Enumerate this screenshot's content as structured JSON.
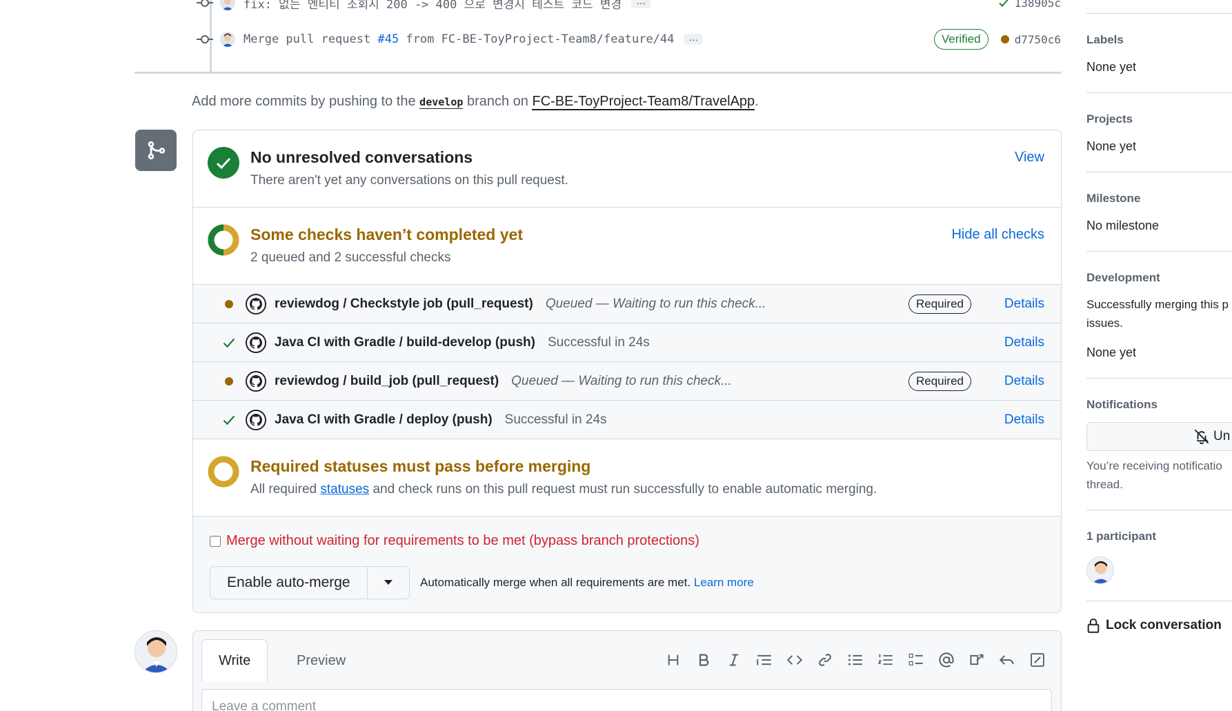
{
  "commits": [
    {
      "message_prefix": "fix: 없는 엔티티 조회시 200 -> 400 으로 변경시 테스트 코드 변경",
      "pr": "",
      "suffix": "",
      "sha": "138905c",
      "status": "success"
    },
    {
      "message_prefix": "Merge pull request",
      "pr": "#45",
      "suffix": "from FC-BE-ToyProject-Team8/feature/44",
      "sha": "d7750c6",
      "status": "pending",
      "badge": "Verified"
    }
  ],
  "add_more": {
    "pre": "Add more commits by pushing to the",
    "branch": "develop",
    "mid": "branch on",
    "repo": "FC-BE-ToyProject-Team8/TravelApp",
    "post": "."
  },
  "conversations": {
    "title": "No unresolved conversations",
    "subtitle": "There aren't yet any conversations on this pull request.",
    "action": "View"
  },
  "checks_summary": {
    "title": "Some checks haven’t completed yet",
    "subtitle": "2 queued and 2 successful checks",
    "action": "Hide all checks"
  },
  "checks": [
    {
      "status": "queued",
      "name": "reviewdog / Checkstyle job (pull_request)",
      "desc": "Queued — Waiting to run this check...",
      "required": "Required",
      "details": "Details"
    },
    {
      "status": "success",
      "name": "Java CI with Gradle / build-develop (push)",
      "desc": "Successful in 24s",
      "required": "",
      "details": "Details"
    },
    {
      "status": "queued",
      "name": "reviewdog / build_job (pull_request)",
      "desc": "Queued — Waiting to run this check...",
      "required": "Required",
      "details": "Details"
    },
    {
      "status": "success",
      "name": "Java CI with Gradle / deploy (push)",
      "desc": "Successful in 24s",
      "required": "",
      "details": "Details"
    }
  ],
  "required_statuses": {
    "title": "Required statuses must pass before merging",
    "sub_pre": "All required",
    "sub_link": "statuses",
    "sub_post": "and check runs on this pull request must run successfully to enable automatic merging."
  },
  "bypass": {
    "label": "Merge without waiting for requirements to be met (bypass branch protections)"
  },
  "automerge": {
    "button": "Enable auto-merge",
    "text": "Automatically merge when all requirements are met.",
    "link": "Learn more"
  },
  "comment": {
    "tabs": [
      "Write",
      "Preview"
    ],
    "placeholder": "Leave a comment"
  },
  "sidebar": {
    "labels": {
      "title": "Labels",
      "value": "None yet"
    },
    "projects": {
      "title": "Projects",
      "value": "None yet"
    },
    "milestone": {
      "title": "Milestone",
      "value": "No milestone"
    },
    "development": {
      "title": "Development",
      "line1": "Successfully merging this p",
      "line2": "issues.",
      "value": "None yet"
    },
    "notifications": {
      "title": "Notifications",
      "button": "Un",
      "line1": "You’re receiving notificatio",
      "line2": "thread."
    },
    "participants": {
      "title": "1 participant"
    },
    "lock": "Lock conversation"
  },
  "colors": {
    "success": "#1a7f37",
    "pending": "#9a6700",
    "accent": "#0969da",
    "danger": "#d1242f",
    "ring": "#d4a72c"
  }
}
